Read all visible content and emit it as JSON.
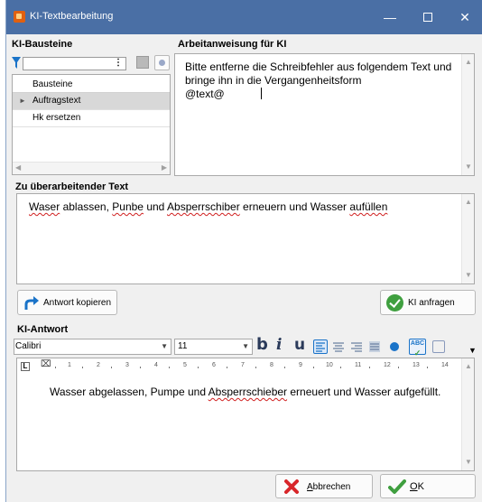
{
  "window": {
    "title": "KI-Textbearbeitung"
  },
  "bausteine": {
    "label": "KI-Bausteine",
    "filter_value": "",
    "column_header": "Bausteine",
    "rows": [
      {
        "label": "Auftragstext",
        "selected": true
      },
      {
        "label": "Hk ersetzen",
        "selected": false
      }
    ]
  },
  "arbeitsanweisung": {
    "label": "Arbeitanweisung für KI",
    "lines": [
      "Bitte entferne die Schreibfehler aus folgendem Text und",
      "bringe ihn in die Vergangenheitsform",
      "@text@"
    ]
  },
  "input_text": {
    "label": "Zu überarbeitender Text",
    "w1": "Waser",
    "t1": " ablassen, ",
    "w2": "Punbe",
    "t2": " und ",
    "w3": "Absperrschiber",
    "t3": "  erneuern und Wasser ",
    "w4": "aufüllen"
  },
  "buttons": {
    "copy_answer": "Antwort kopieren",
    "ask_ai": "KI anfragen",
    "cancel_prefix": "",
    "cancel_mnemonic": "A",
    "cancel_rest": "bbrechen",
    "ok_mnemonic": "O",
    "ok_rest": "K"
  },
  "ki_antwort": {
    "label": "KI-Antwort",
    "font": "Calibri",
    "size": "11",
    "bold": "b",
    "italic": "i",
    "underline": "u",
    "ruler_numbers": [
      "1",
      "2",
      "3",
      "4",
      "5",
      "6",
      "7",
      "8",
      "9",
      "10",
      "11",
      "12",
      "13",
      "14"
    ],
    "text_before": "Wasser abgelassen, Pumpe und ",
    "text_flag": "Absperrschieber",
    "text_after": " erneuert und Wasser aufgefüllt."
  },
  "colors": {
    "titlebar": "#4a6fa5",
    "accent_blue": "#1a73c8",
    "success_green": "#3f9f3f",
    "cancel_red": "#d8262a"
  },
  "icons": [
    "app-icon",
    "minimize-icon",
    "maximize-icon",
    "close-icon",
    "filter-icon",
    "more-icon",
    "grid-icon",
    "settings-icon",
    "share-arrow-icon",
    "check-icon",
    "x-icon",
    "tab-stop-icon"
  ]
}
